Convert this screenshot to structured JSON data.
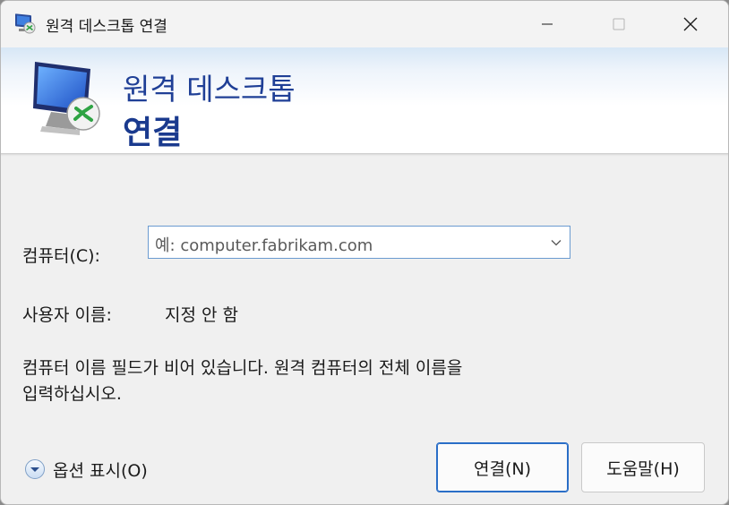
{
  "window": {
    "title": "원격 데스크톱 연결"
  },
  "banner": {
    "line1": "원격 데스크톱",
    "line2": "연결"
  },
  "form": {
    "computer_label": "컴퓨터(C):",
    "computer_placeholder": "예: computer.fabrikam.com",
    "user_label": "사용자 이름:",
    "user_value": "지정 안 함",
    "message_line1": "컴퓨터 이름 필드가 비어 있습니다. 원격 컴퓨터의 전체 이름을",
    "message_line2": "입력하십시오."
  },
  "footer": {
    "show_options": "옵션 표시(O)",
    "connect_button": "연결(N)",
    "help_button": "도움말(H)"
  },
  "icons": {
    "title_icon": "remote-desktop-icon",
    "banner_icon": "remote-desktop-monitor-icon",
    "options_icon": "expand-chevron-icon",
    "combo_icon": "chevron-down-icon"
  },
  "colors": {
    "banner_title": "#1f3f96",
    "accent_border": "#2a6ec7"
  }
}
